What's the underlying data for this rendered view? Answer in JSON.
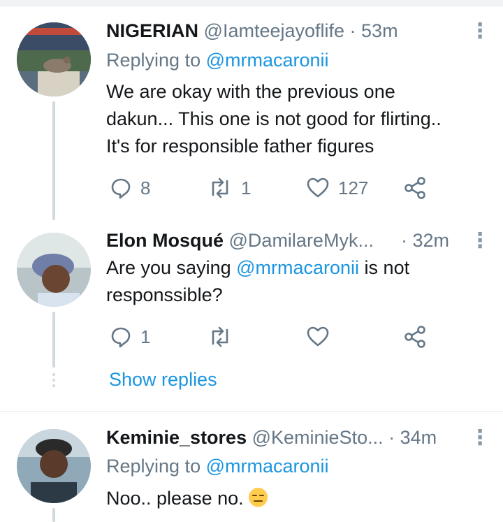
{
  "colors": {
    "accent": "#1b95e0",
    "muted": "#657786",
    "line": "#cfd9de"
  },
  "tweets": [
    {
      "name": "NIGERIAN",
      "handle": "@Iamteejayoflife",
      "time": "· 53m",
      "replying_label": "Replying to",
      "replying_to": "@mrmacaronii",
      "lines": [
        "We are okay with the previous one",
        "dakun... This one is not good for flirting..",
        "It's for responsible father figures"
      ],
      "reply_count": "8",
      "retweet_count": "1",
      "like_count": "127"
    },
    {
      "name": "Elon Mosqué",
      "handle": "@DamilareMyk...",
      "time": "· 32m",
      "text_pre": "Are you saying ",
      "mention": "@mrmacaronii",
      "text_post": " is not",
      "line2": "responssible?",
      "reply_count": "1"
    },
    {
      "name": "Keminie_stores",
      "handle": "@KeminieSto...",
      "time": "· 34m",
      "replying_label": "Replying to",
      "replying_to": "@mrmacaronii",
      "text": "Noo.. please no."
    }
  ],
  "show_replies": "Show replies",
  "icons": [
    "reply-icon",
    "retweet-icon",
    "like-icon",
    "share-icon",
    "more-icon"
  ]
}
